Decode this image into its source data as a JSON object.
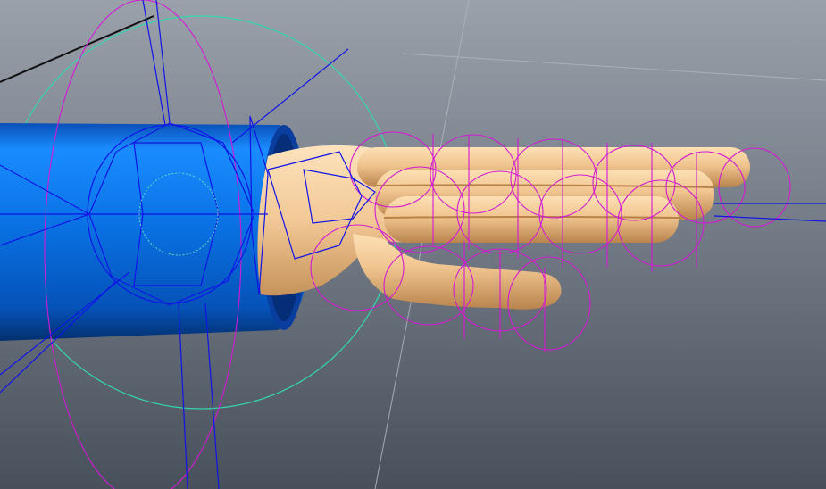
{
  "viewport": {
    "background_top": "#9aa1ab",
    "background_bottom": "#48505c",
    "grid_color": "#aeb4bb"
  },
  "scene": {
    "sleeve_color": "#0a73e6",
    "sleeve_dark": "#043a8a",
    "sleeve_rim": "#0b2e78",
    "hand_skin": "#f2c896",
    "hand_shadow": "#c6925a",
    "joint_wire_color": "#d21ad2",
    "wrist_wire_color": "#1014e6",
    "ik_circle_color": "#33d6b0",
    "guide_line_color": "#101010"
  }
}
